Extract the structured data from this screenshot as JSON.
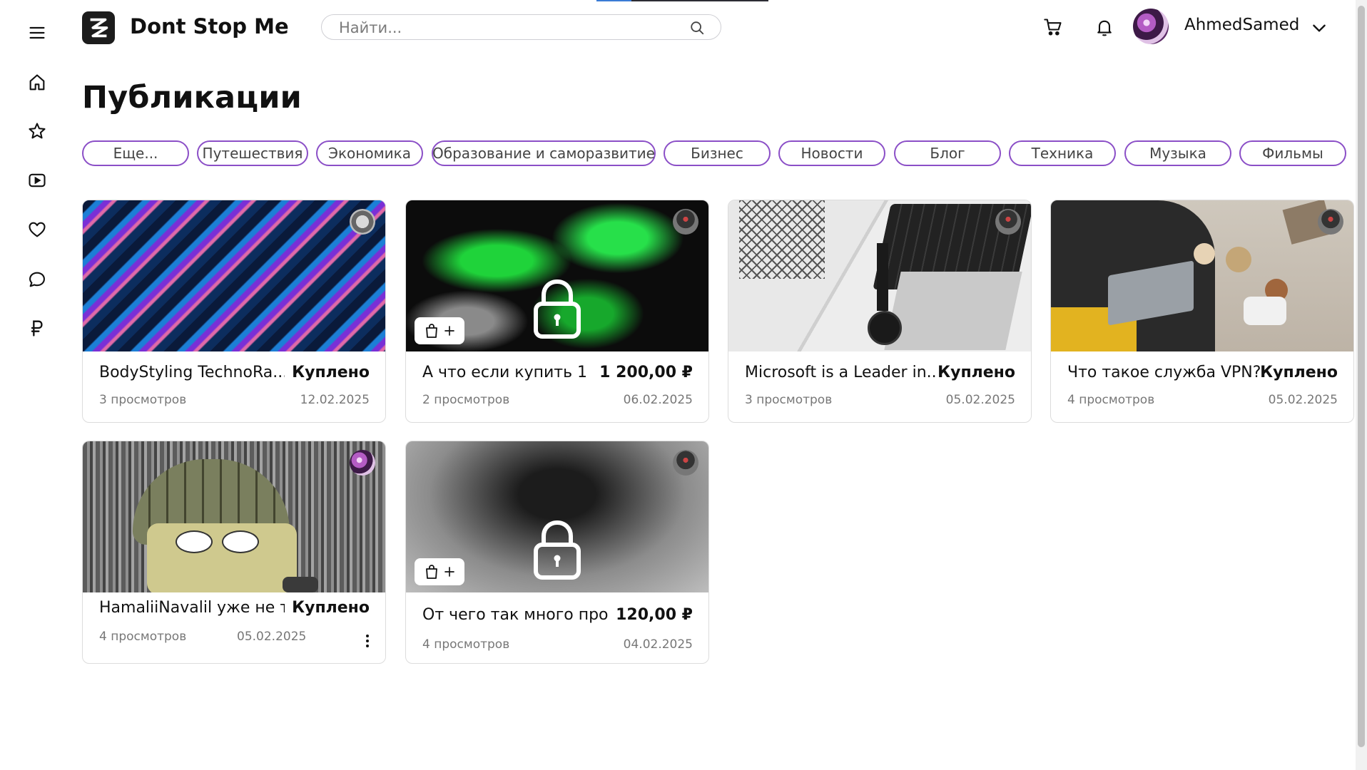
{
  "app": {
    "name": "Dont Stop Me"
  },
  "search": {
    "placeholder": "Найти..."
  },
  "user": {
    "name": "AhmedSamed"
  },
  "page": {
    "title": "Публикации"
  },
  "colors": {
    "accent": "#8b4fc7",
    "text": "#111111",
    "muted": "#777777",
    "card_border": "#dcdcdc"
  },
  "sidebar": {
    "items": [
      {
        "icon": "menu-icon"
      },
      {
        "icon": "home-icon"
      },
      {
        "icon": "star-icon"
      },
      {
        "icon": "video-icon"
      },
      {
        "icon": "heart-icon"
      },
      {
        "icon": "chat-icon"
      },
      {
        "icon": "ruble-icon"
      }
    ]
  },
  "header": {
    "icons": [
      "cart-icon",
      "bell-icon",
      "chevron-down-icon"
    ]
  },
  "categories": [
    "Еще...",
    "Путешествия",
    "Экономика",
    "Образование и саморазвитие",
    "Бизнес",
    "Новости",
    "Блог",
    "Техника",
    "Музыка",
    "Фильмы"
  ],
  "posts": [
    {
      "title": "BodyStyling TechnoRa...",
      "status": "Куплено",
      "views": "3 просмотров",
      "date": "12.02.2025"
    },
    {
      "title": "А что если купить 1...",
      "status": "1 200,00 ₽",
      "views": "2 просмотров",
      "date": "06.02.2025",
      "locked": true
    },
    {
      "title": "Microsoft is a Leader in...",
      "status": "Куплено",
      "views": "3 просмотров",
      "date": "05.02.2025"
    },
    {
      "title": "Что такое служба VPN?",
      "status": "Куплено",
      "views": "4 просмотров",
      "date": "05.02.2025"
    },
    {
      "title": "HamaliiNavalil уже не т...",
      "status": "Куплено",
      "views": "4 просмотров",
      "date": "05.02.2025"
    },
    {
      "title": "От чего так много про...",
      "status": "120,00 ₽",
      "views": "4 просмотров",
      "date": "04.02.2025",
      "locked": true
    }
  ]
}
